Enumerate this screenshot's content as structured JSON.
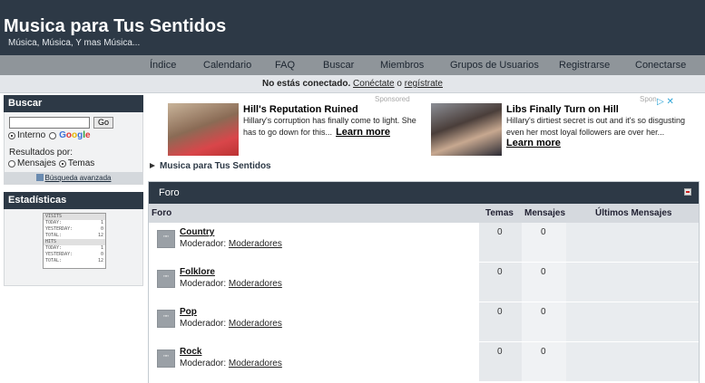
{
  "site": {
    "title": "Musica para Tus Sentidos",
    "subtitle": "Música, Música, Y mas Música..."
  },
  "nav": {
    "items": [
      "Índice",
      "Calendario",
      "FAQ",
      "Buscar",
      "Miembros",
      "Grupos de Usuarios",
      "Registrarse",
      "Conectarse"
    ]
  },
  "status": {
    "not_connected": "No estás conectado.",
    "connect_link": "Conéctate",
    "or": "o",
    "register_link": "regístrate"
  },
  "search_panel": {
    "title": "Buscar",
    "go_label": "Go",
    "radio_internal": "Interno",
    "radio_google": "Google",
    "results_label": "Resultados por:",
    "radio_messages": "Mensajes",
    "radio_topics": "Temas",
    "advanced_link": "Búsqueda avanzada"
  },
  "stats_panel": {
    "title": "Estadísticas",
    "counter": {
      "visits_header": "VISITS",
      "hits_header": "HITS",
      "visits": [
        {
          "label": "TODAY:",
          "value": "1"
        },
        {
          "label": "YESTERDAY:",
          "value": "0"
        },
        {
          "label": "TOTAL:",
          "value": "12"
        }
      ],
      "hits": [
        {
          "label": "TODAY:",
          "value": "1"
        },
        {
          "label": "YESTERDAY:",
          "value": "0"
        },
        {
          "label": "TOTAL:",
          "value": "12"
        }
      ]
    }
  },
  "ads": {
    "sponsored_label": "Sponsored",
    "sponsored_label_short": "Spon",
    "ad1": {
      "title": "Hill's Reputation Ruined",
      "desc_line1": "Hillary's corruption has finally come to light. She",
      "desc_line2": "has to go down for this...",
      "cta": "Learn more"
    },
    "ad2": {
      "title": "Libs Finally Turn on Hill",
      "desc_line1": "Hillary's dirtiest secret is out and it's so disgusting",
      "desc_line2": "even her most loyal followers are over her...",
      "cta": "Learn more"
    },
    "adchoices_glyph": "▷ ✕"
  },
  "breadcrumb": {
    "label": "Musica para Tus Sentidos"
  },
  "forum": {
    "section_title": "Foro",
    "columns": {
      "forum": "Foro",
      "topics": "Temas",
      "messages": "Mensajes",
      "last_messages": "Últimos Mensajes"
    },
    "moderator_label": "Moderador:",
    "icon_glyph": "\"\"",
    "rows": [
      {
        "name": "Country",
        "moderator": "Moderadores",
        "topics": "0",
        "messages": "0"
      },
      {
        "name": "Folklore",
        "moderator": "Moderadores",
        "topics": "0",
        "messages": "0"
      },
      {
        "name": "Pop",
        "moderator": "Moderadores",
        "topics": "0",
        "messages": "0"
      },
      {
        "name": "Rock",
        "moderator": "Moderadores",
        "topics": "0",
        "messages": "0"
      }
    ]
  }
}
